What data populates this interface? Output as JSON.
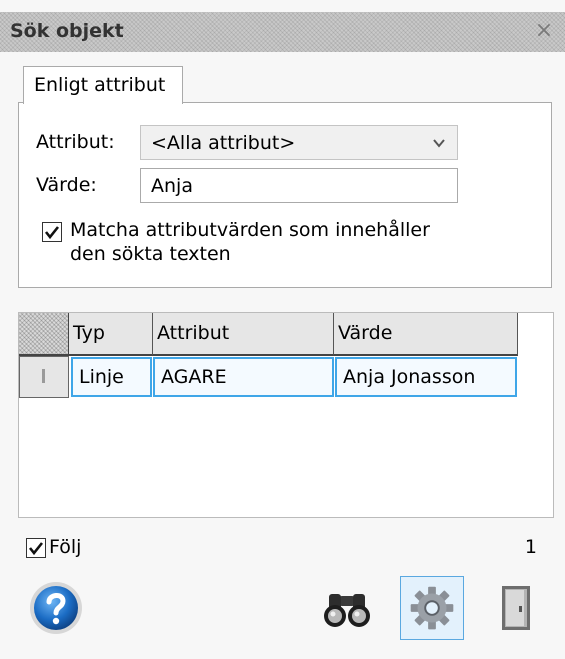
{
  "window": {
    "title": "Sök objekt",
    "close_glyph": "×"
  },
  "tabs": [
    {
      "label": "Enligt attribut",
      "active": true
    }
  ],
  "form": {
    "attribute_label": "Attribut:",
    "attribute_value": "<Alla attribut>",
    "value_label": "Värde:",
    "value_text": "Anja",
    "match_checked": true,
    "match_line1": "Matcha attributvärden som innehåller",
    "match_line2": "den sökta texten"
  },
  "results": {
    "columns": [
      "Typ",
      "Attribut",
      "Värde"
    ],
    "rows": [
      {
        "typ": "Linje",
        "attribut": "AGARE",
        "varde": "Anja Jonasson"
      }
    ]
  },
  "footer": {
    "follow_checked": true,
    "follow_label": "Följ",
    "count": "1"
  },
  "buttons": [
    {
      "name": "help",
      "icon": "question-icon"
    },
    {
      "name": "search",
      "icon": "binoculars-icon"
    },
    {
      "name": "settings",
      "icon": "gear-icon"
    },
    {
      "name": "exit",
      "icon": "door-icon"
    }
  ],
  "colors": {
    "accent": "#3fa6e8",
    "help_blue": "#1b6cc4"
  }
}
